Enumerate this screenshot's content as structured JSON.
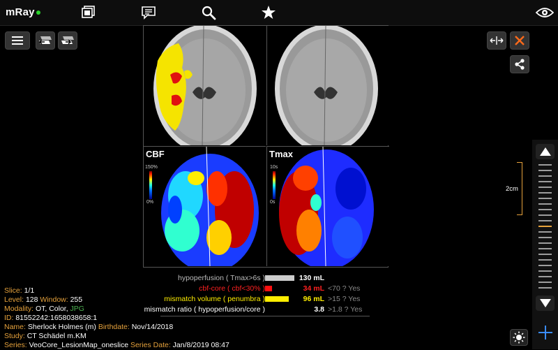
{
  "app": {
    "logo": "mRay",
    "status_color": "#2bd32b"
  },
  "toolbar": {
    "icons": [
      "studies-icon",
      "comments-icon",
      "search-icon",
      "star-icon",
      "eye-icon"
    ]
  },
  "panes": {
    "cbf": {
      "label": "CBF",
      "scale_max": "150%",
      "scale_min": "0%"
    },
    "tmax": {
      "label": "Tmax",
      "scale_max": "10s",
      "scale_min": "0s"
    }
  },
  "legend": [
    {
      "label": "hypoperfusion ( Tmax>6s )",
      "swatch": "#cccccc",
      "value": "130 mL",
      "threshold": "",
      "label_color": "#bbbbbb",
      "value_color": "#ffffff"
    },
    {
      "label": "cbf-core ( cbf<30% )",
      "swatch": "#ff1010",
      "value": "34 mL",
      "threshold": "<70 ? Yes",
      "label_color": "#ff2020",
      "value_color": "#ff2020"
    },
    {
      "label": "mismatch volume ( penumbra )",
      "swatch": "#ffee00",
      "value": "96 mL",
      "threshold": ">15 ? Yes",
      "label_color": "#ffee00",
      "value_color": "#ffee00"
    },
    {
      "label": "mismatch ratio ( hypoperfusion/core )",
      "swatch": "",
      "value": "3.8",
      "threshold": ">1.8 ? Yes",
      "label_color": "#ffffff",
      "value_color": "#ffffff"
    }
  ],
  "overlay": {
    "slice_key": "Slice:",
    "slice_val": "1/1",
    "level_key": "Level:",
    "level_val": "128",
    "window_key": "Window:",
    "window_val": "255",
    "modality_key": "Modality:",
    "modality_val": "OT, Color,",
    "modality_fmt": "JPG",
    "id_key": "ID:",
    "id_val": "81552242:1658038658:1",
    "name_key": "Name:",
    "name_val": "Sherlock Holmes (m)",
    "birth_key": "Birthdate:",
    "birth_val": "Nov/14/2018",
    "study_key": "Study:",
    "study_val": "CT Schädel m.KM",
    "series_key": "Series:",
    "series_val": "VeoCore_LesionMap_oneslice",
    "seriesdate_key": "Series Date:",
    "seriesdate_val": "Jan/8/2019 08:47"
  },
  "ruler": {
    "label": "2cm"
  }
}
